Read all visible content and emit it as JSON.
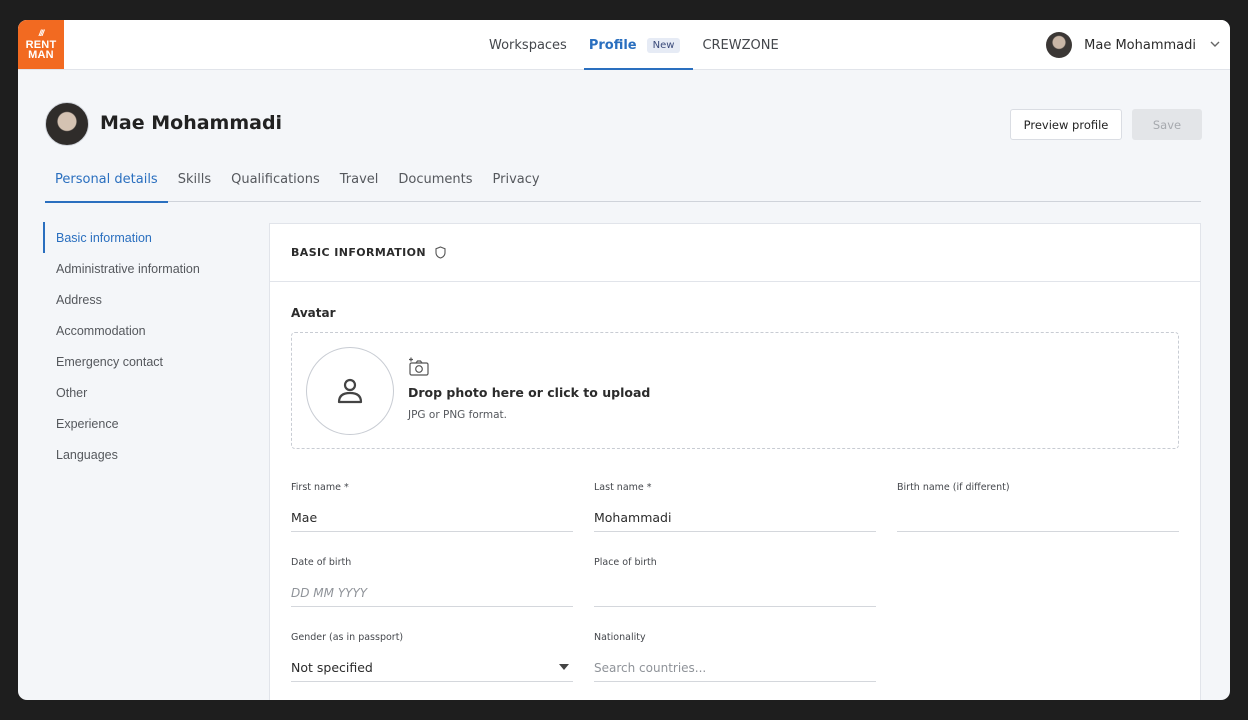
{
  "app": {
    "logo_line1": "RENT",
    "logo_line2": "MAN",
    "logo_mark": "///"
  },
  "nav": {
    "items": [
      {
        "label": "Workspaces"
      },
      {
        "label": "Profile",
        "badge": "New"
      },
      {
        "label": "CREWZONE"
      }
    ],
    "user_name": "Mae Mohammadi"
  },
  "header": {
    "name": "Mae Mohammadi",
    "preview_label": "Preview profile",
    "save_label": "Save"
  },
  "tabs": [
    "Personal details",
    "Skills",
    "Qualifications",
    "Travel",
    "Documents",
    "Privacy"
  ],
  "sidebar": {
    "items": [
      "Basic information",
      "Administrative information",
      "Address",
      "Accommodation",
      "Emergency contact",
      "Other",
      "Experience",
      "Languages"
    ]
  },
  "card": {
    "title": "BASIC INFORMATION",
    "avatar_label": "Avatar",
    "drop_title": "Drop photo here or click to upload",
    "drop_sub": "JPG or PNG format."
  },
  "fields": {
    "first_name": {
      "label": "First name *",
      "value": "Mae"
    },
    "last_name": {
      "label": "Last name *",
      "value": "Mohammadi"
    },
    "birth_name": {
      "label": "Birth name (if different)",
      "value": ""
    },
    "dob": {
      "label": "Date of birth",
      "placeholder": "DD MM YYYY"
    },
    "pob": {
      "label": "Place of birth",
      "value": ""
    },
    "gender": {
      "label": "Gender (as in passport)",
      "value": "Not specified"
    },
    "nationality": {
      "label": "Nationality",
      "placeholder": "Search countries..."
    }
  },
  "colors": {
    "accent": "#2a6fbf",
    "brand": "#f26a21"
  }
}
